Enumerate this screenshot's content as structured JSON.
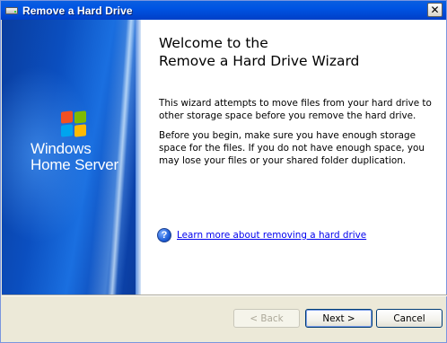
{
  "window": {
    "title": "Remove a Hard Drive",
    "close_label": "✕"
  },
  "branding": {
    "line1": "Windows",
    "line2": "Home Server"
  },
  "content": {
    "title_line1": "Welcome to the",
    "title_line2": "Remove a Hard Drive Wizard",
    "paragraph1": "This wizard attempts to move files from your hard drive to other storage space before you remove the hard drive.",
    "paragraph2": "Before you begin, make sure you have enough storage space for the files.  If you do not have enough space, you may lose your files or your shared folder duplication.",
    "help_icon": "?",
    "help_link": "Learn more about removing a hard drive"
  },
  "buttons": {
    "back": "< Back",
    "next": "Next >",
    "cancel": "Cancel"
  },
  "icons": {
    "title": "hard-drive-icon",
    "help": "help-icon",
    "logo": "windows-logo"
  },
  "colors": {
    "titlebar": "#0054e3",
    "link": "#0000ee",
    "panel_blue": "#0b4fc0"
  }
}
